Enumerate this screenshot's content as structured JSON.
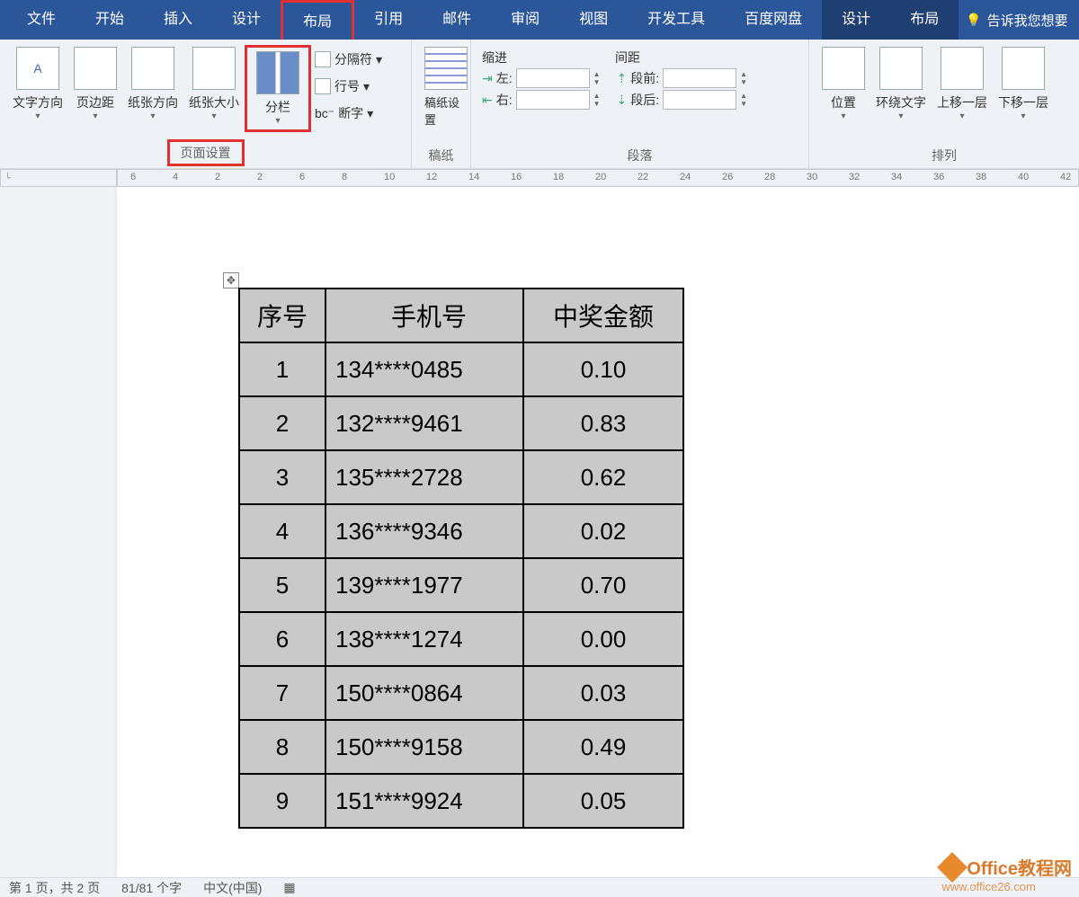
{
  "menu": {
    "file": "文件",
    "home": "开始",
    "insert": "插入",
    "design": "设计",
    "layout": "布局",
    "refs": "引用",
    "mail": "邮件",
    "review": "审阅",
    "view": "视图",
    "dev": "开发工具",
    "baidu": "百度网盘",
    "design2": "设计",
    "layout2": "布局",
    "tellme": "告诉我您想要"
  },
  "ribbon": {
    "textdir": "文字方向",
    "margins": "页边距",
    "orient": "纸张方向",
    "size": "纸张大小",
    "columns": "分栏",
    "breaks": "分隔符",
    "linenum": "行号",
    "hyph": "断字",
    "page_setup": "页面设置",
    "gao": "稿纸设置",
    "gao_group": "稿纸",
    "indent_label": "缩进",
    "indent_left": "左:",
    "indent_right": "右:",
    "spacing_label": "间距",
    "spacing_before": "段前:",
    "spacing_after": "段后:",
    "paragraph": "段落",
    "position": "位置",
    "wrap": "环绕文字",
    "bring": "上移一层",
    "send": "下移一层",
    "arrange": "排列"
  },
  "ruler_marks": [
    "6",
    "4",
    "2",
    "2",
    "6",
    "8",
    "10",
    "12",
    "14",
    "16",
    "18",
    "20",
    "22",
    "24",
    "26",
    "28",
    "30",
    "32",
    "34",
    "36",
    "38",
    "40",
    "42"
  ],
  "table": {
    "headers": [
      "序号",
      "手机号",
      "中奖金额"
    ],
    "rows": [
      [
        "1",
        "134****0485",
        "0.10"
      ],
      [
        "2",
        "132****9461",
        "0.83"
      ],
      [
        "3",
        "135****2728",
        "0.62"
      ],
      [
        "4",
        "136****9346",
        "0.02"
      ],
      [
        "5",
        "139****1977",
        "0.70"
      ],
      [
        "6",
        "138****1274",
        "0.00"
      ],
      [
        "7",
        "150****0864",
        "0.03"
      ],
      [
        "8",
        "150****9158",
        "0.49"
      ],
      [
        "9",
        "151****9924",
        "0.05"
      ]
    ]
  },
  "status": {
    "page": "第 1 页，共 2 页",
    "words": "81/81 个字",
    "lang": "中文(中国)"
  },
  "watermark": {
    "title": "Office教程网",
    "url": "www.office26.com"
  }
}
